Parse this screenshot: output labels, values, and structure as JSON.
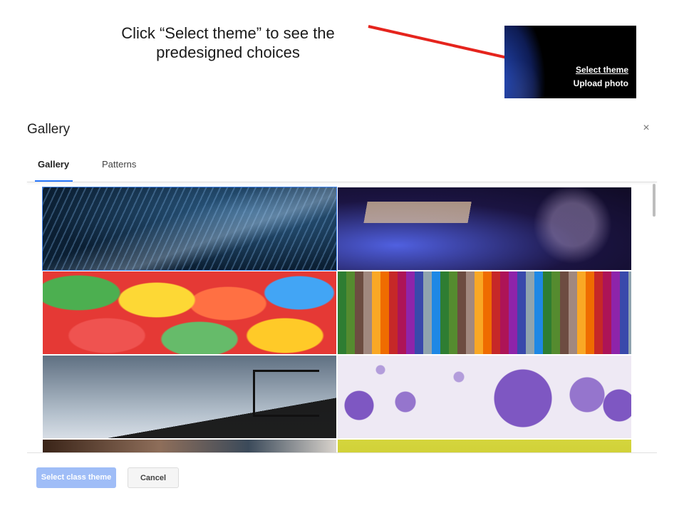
{
  "annotation": {
    "instruction": "Click “Select theme” to see the predesigned choices"
  },
  "header_preview": {
    "select_theme_link": "Select theme",
    "upload_photo_link": "Upload photo"
  },
  "dialog": {
    "title": "Gallery",
    "close_icon": "×",
    "tabs": [
      {
        "label": "Gallery",
        "selected": true
      },
      {
        "label": "Patterns",
        "selected": false
      }
    ],
    "accent_color": "#2979ff",
    "tiles": [
      {
        "name": "fiber-optics-theme"
      },
      {
        "name": "guitar-theme"
      },
      {
        "name": "candy-theme"
      },
      {
        "name": "yarn-theme"
      },
      {
        "name": "basketball-theme"
      },
      {
        "name": "purple-spheres-theme"
      },
      {
        "name": "partial-theme-left"
      },
      {
        "name": "partial-theme-right"
      }
    ],
    "selected_tile_index": 0,
    "buttons": {
      "primary": "Select class theme",
      "cancel": "Cancel"
    }
  },
  "colors": {
    "primary_button_disabled": "#9fbdf7",
    "arrow": "#e5241d"
  }
}
